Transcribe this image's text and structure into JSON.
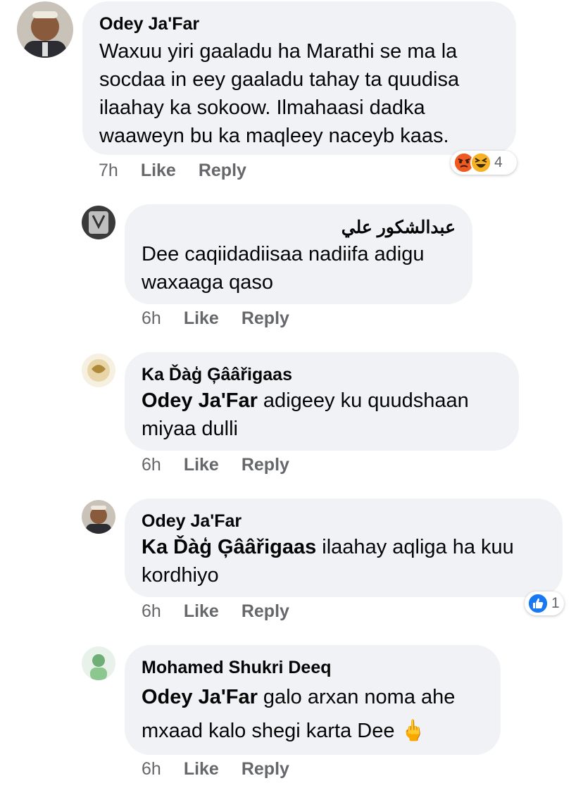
{
  "comments": [
    {
      "author": "Odey Ja'Far",
      "mention": "",
      "text": "Waxuu yiri gaaladu ha Marathi se ma la socdaa in eey gaaladu tahay ta quudisa ilaahay ka sokoow. Ilmahaasi dadka waaweyn bu ka maqleey naceyb kaas.",
      "time": "7h",
      "like": "Like",
      "reply": "Reply",
      "reaction_count": "4",
      "reaction_icons": [
        "angry-icon",
        "haha-icon"
      ]
    },
    {
      "author": "عبدالشكور علي",
      "mention": "",
      "text": "Dee caqiidadiisaa nadiifa adigu waxaaga qaso",
      "time": "6h",
      "like": "Like",
      "reply": "Reply"
    },
    {
      "author": "Ka Ďàģ Ģââřigaas",
      "mention": "Odey Ja'Far",
      "text": " adigeey ku quudshaan miyaa dulli",
      "time": "6h",
      "like": "Like",
      "reply": "Reply"
    },
    {
      "author": "Odey Ja'Far",
      "mention": "Ka Ďàģ Ģââřigaas",
      "text": " ilaahay aqliga ha kuu kordhiyo",
      "time": "6h",
      "like": "Like",
      "reply": "Reply",
      "reaction_count": "1",
      "reaction_icons": [
        "like-icon"
      ]
    },
    {
      "author": "Mohamed Shukri Deeq",
      "mention": "Odey Ja'Far",
      "text": " galo arxan noma ahe mxaad kalo shegi karta Dee 🖕",
      "time": "6h",
      "like": "Like",
      "reply": "Reply"
    }
  ],
  "colors": {
    "bubble": "#f0f2f5",
    "meta": "#65676b",
    "like_blue": "#1877f2",
    "angry": "#e9710f",
    "haha": "#f7b125"
  }
}
